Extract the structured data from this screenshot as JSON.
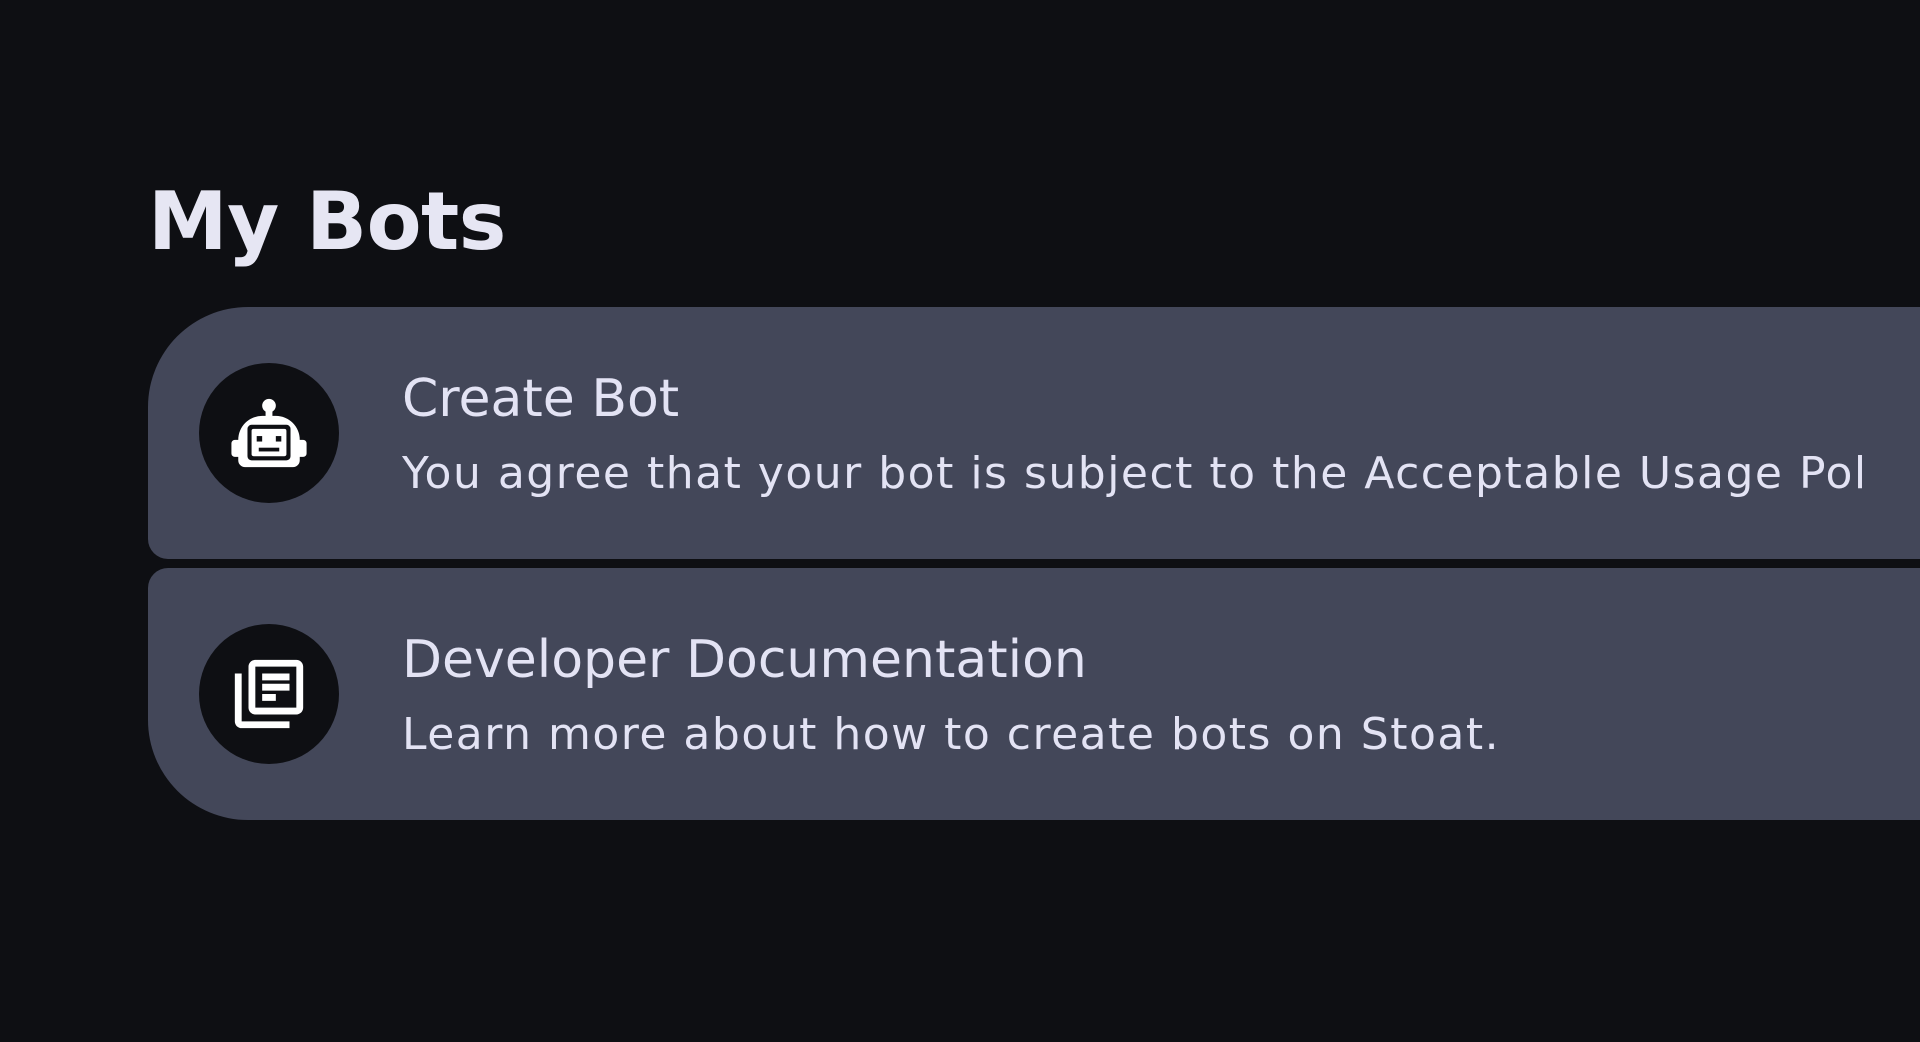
{
  "page": {
    "title": "My Bots"
  },
  "cards": [
    {
      "title": "Create Bot",
      "description": "You agree that your bot is subject to the Acceptable Usage Pol",
      "icon": "robot-icon"
    },
    {
      "title": "Developer Documentation",
      "description": "Learn more about how to create bots on Stoat.",
      "icon": "library-books-icon"
    }
  ],
  "colors": {
    "background": "#0e0f13",
    "card": "#434759",
    "text": "#e6e6f3"
  }
}
